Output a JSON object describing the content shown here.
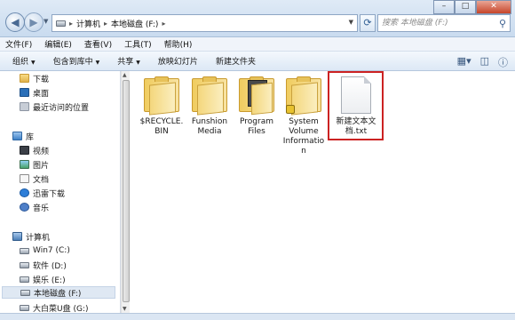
{
  "address": {
    "crumbs": [
      "计算机",
      "本地磁盘 (F:)"
    ],
    "search_placeholder": "搜索 本地磁盘 (F:)"
  },
  "menu": [
    "文件(F)",
    "编辑(E)",
    "查看(V)",
    "工具(T)",
    "帮助(H)"
  ],
  "toolbar": [
    "组织",
    "包含到库中",
    "共享",
    "放映幻灯片",
    "新建文件夹"
  ],
  "sidebar": {
    "favorites": [
      "下载",
      "桌面",
      "最近访问的位置"
    ],
    "library_header": "库",
    "libraries": [
      "视频",
      "图片",
      "文档",
      "迅雷下载",
      "音乐"
    ],
    "computer_header": "计算机",
    "drives": [
      "Win7 (C:)",
      "软件 (D:)",
      "娱乐 (E:)",
      "本地磁盘 (F:)",
      "大白菜U盘 (G:)"
    ]
  },
  "files": [
    {
      "name": "$RECYCLE.BIN",
      "line1": "$RECYCLE.",
      "line2": "BIN",
      "line3": "",
      "line4": ""
    },
    {
      "name": "Funshion Media",
      "line1": "Funshion",
      "line2": "Media",
      "line3": "",
      "line4": ""
    },
    {
      "name": "Program Files",
      "line1": "Program",
      "line2": "Files",
      "line3": "",
      "line4": ""
    },
    {
      "name": "System Volume Information",
      "line1": "System",
      "line2": "Volume",
      "line3": "Informatio",
      "line4": "n"
    },
    {
      "name": "新建文本文档.txt",
      "line1": "新建文本文",
      "line2": "档.txt",
      "line3": "",
      "line4": ""
    }
  ],
  "colors": {
    "highlight": "#cc2222",
    "selected_bg": "#dfe8f3"
  }
}
